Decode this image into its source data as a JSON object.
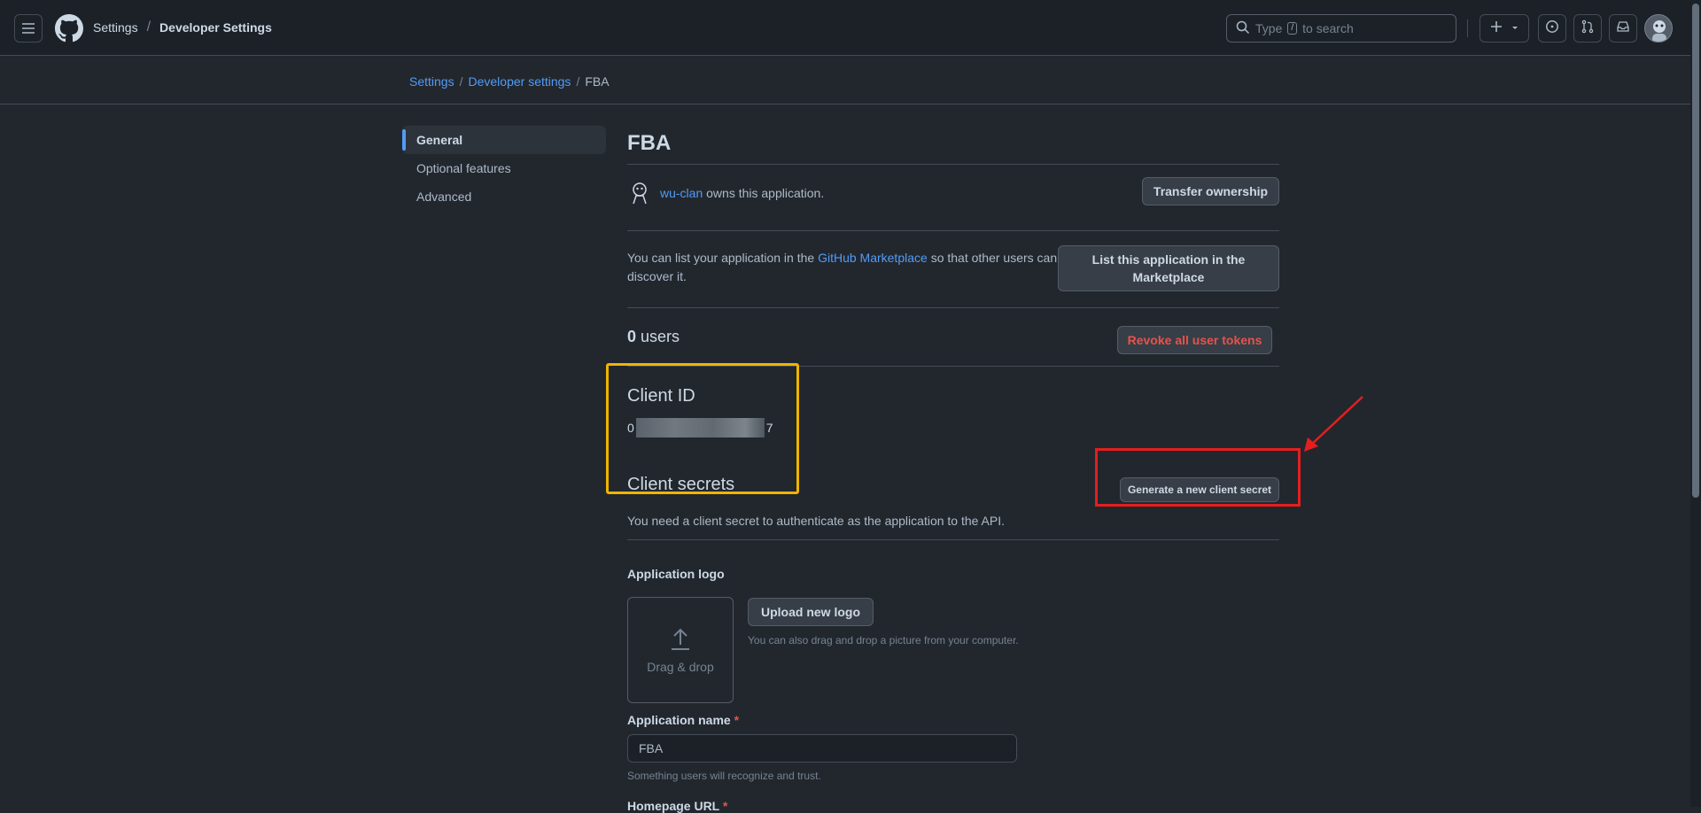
{
  "header": {
    "context_root": "Settings",
    "context_separator": "/",
    "context_current": "Developer Settings",
    "search_prefix": "Type",
    "search_key": "/",
    "search_suffix": "to search",
    "icons": [
      "hamburger-icon",
      "github-logo-icon",
      "search-icon",
      "plus-icon",
      "triangle-down-icon",
      "issue-icon",
      "pull-request-icon",
      "inbox-icon"
    ]
  },
  "breadcrumb": {
    "items": [
      "Settings",
      "Developer settings"
    ],
    "separator": "/",
    "current": "FBA"
  },
  "sidebar": {
    "items": [
      {
        "label": "General",
        "active": true
      },
      {
        "label": "Optional features",
        "active": false
      },
      {
        "label": "Advanced",
        "active": false
      }
    ]
  },
  "app": {
    "title": "FBA",
    "owner": "wu-clan",
    "owner_suffix": "owns this application.",
    "transfer_button": "Transfer ownership",
    "marketplace_prefix": "You can list your application in the",
    "marketplace_link": "GitHub Marketplace",
    "marketplace_suffix": "so that other users can discover it.",
    "marketplace_button": "List this application in the Marketplace",
    "users_count": "0",
    "users_label": "users",
    "revoke_button": "Revoke all user tokens",
    "client_id_heading": "Client ID",
    "client_id_start": "0",
    "client_id_end": "7",
    "client_secrets_heading": "Client secrets",
    "generate_secret_button": "Generate a new client secret",
    "secret_description": "You need a client secret to authenticate as the application to the API."
  },
  "form": {
    "logo_label": "Application logo",
    "dropzone_text": "Drag & drop",
    "upload_button": "Upload new logo",
    "upload_note": "You can also drag and drop a picture from your computer.",
    "name_label": "Application name",
    "required_mark": "*",
    "name_value": "FBA",
    "name_note": "Something users will recognize and trust.",
    "homepage_label": "Homepage URL"
  },
  "colors": {
    "background": "#22272e",
    "accent_link": "#539bf5",
    "danger": "#e5534b",
    "highlight_yellow": "#f0b400",
    "highlight_red": "#e51e1e"
  }
}
